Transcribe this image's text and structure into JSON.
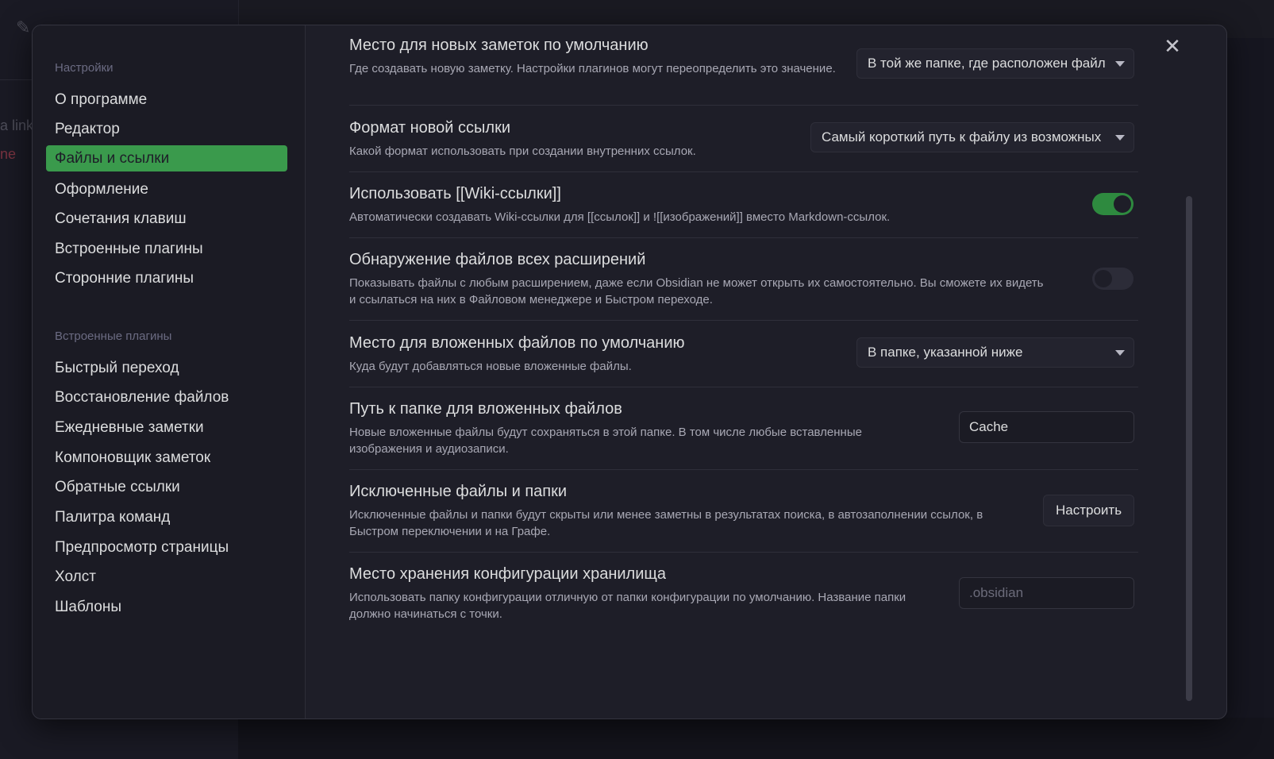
{
  "background": {
    "link_text": "a link",
    "link2_text": "ne"
  },
  "sidebar": {
    "section_settings": "Настройки",
    "settings_items": [
      {
        "label": "О программе"
      },
      {
        "label": "Редактор"
      },
      {
        "label": "Файлы и ссылки",
        "active": true
      },
      {
        "label": "Оформление"
      },
      {
        "label": "Сочетания клавиш"
      },
      {
        "label": "Встроенные плагины"
      },
      {
        "label": "Сторонние плагины"
      }
    ],
    "section_core_plugins": "Встроенные плагины",
    "plugin_items": [
      {
        "label": "Быстрый переход"
      },
      {
        "label": "Восстановление файлов"
      },
      {
        "label": "Ежедневные заметки"
      },
      {
        "label": "Компоновщик заметок"
      },
      {
        "label": "Обратные ссылки"
      },
      {
        "label": "Палитра команд"
      },
      {
        "label": "Предпросмотр страницы"
      },
      {
        "label": "Холст"
      },
      {
        "label": "Шаблоны"
      }
    ]
  },
  "settings": {
    "new_note_location": {
      "name": "Место для новых заметок по умолчанию",
      "desc": "Где создавать новую заметку. Настройки плагинов могут переопределить это значение.",
      "value": "В той же папке, где расположен файл"
    },
    "new_link_format": {
      "name": "Формат новой ссылки",
      "desc": "Какой формат использовать при создании внутренних ссылок.",
      "value": "Самый короткий путь к файлу из возможных"
    },
    "use_wikilinks": {
      "name": "Использовать [[Wiki-ссылки]]",
      "desc": "Автоматически создавать Wiki-ссылки для [[ссылок]] и ![[изображений]] вместо Markdown-ссылок.",
      "enabled": true
    },
    "detect_all_extensions": {
      "name": "Обнаружение файлов всех расширений",
      "desc": "Показывать файлы с любым расширением, даже если Obsidian не может открыть их самостоятельно. Вы сможете их видеть и ссылаться на них в Файловом менеджере и Быстром переходе.",
      "enabled": false
    },
    "attachment_location": {
      "name": "Место для вложенных файлов по умолчанию",
      "desc": "Куда будут добавляться новые вложенные файлы.",
      "value": "В папке, указанной ниже"
    },
    "attachment_folder": {
      "name": "Путь к папке для вложенных файлов",
      "desc": "Новые вложенные файлы будут сохраняться в этой папке. В том числе любые вставленные изображения и аудиозаписи.",
      "value": "Cache"
    },
    "excluded_files": {
      "name": "Исключенные файлы и папки",
      "desc": "Исключенные файлы и папки будут скрыты или менее заметны в результатах поиска, в автозаполнении ссылок, в Быстром переключении и на Графе.",
      "button": "Настроить"
    },
    "config_folder": {
      "name": "Место хранения конфигурации хранилища",
      "desc": "Использовать папку конфигурации отличную от папки конфигурации по умолчанию. Название папки должно начинаться с точки.",
      "placeholder": ".obsidian"
    }
  },
  "icons": {
    "close": "close-icon",
    "edit": "edit-icon"
  }
}
